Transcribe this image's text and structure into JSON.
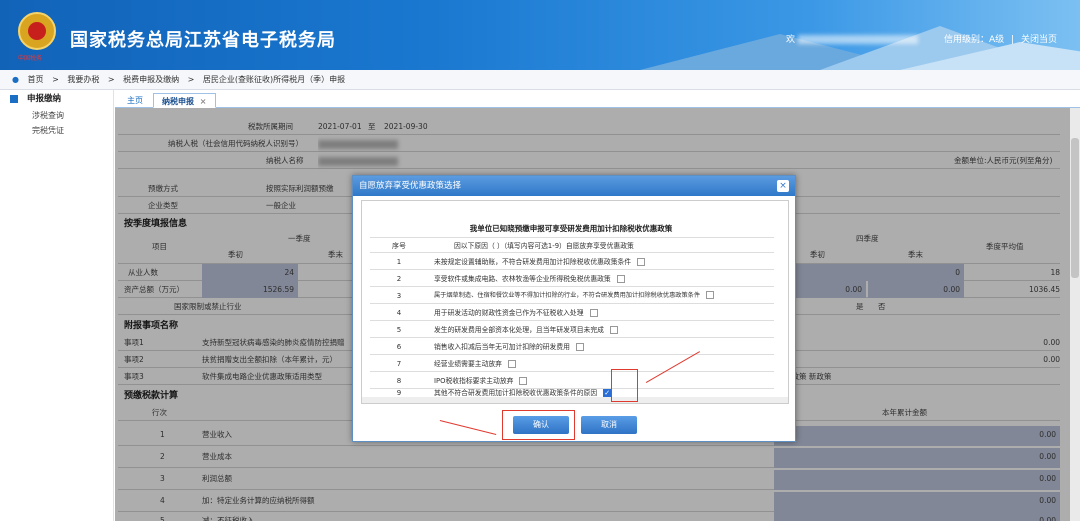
{
  "header": {
    "site_title": "国家税务总局江苏省电子税务局",
    "logo_sub": "中国税务",
    "welcome_prefix": "欢",
    "credit_label": "信用级别：A级",
    "sep": "|",
    "close_label": "关闭当页",
    "colors": {
      "primary": "#1a78d0",
      "accent": "#2e73c5",
      "highlight": "#e03a2f"
    }
  },
  "breadcrumb": {
    "home": "首页",
    "sep": ">",
    "items": [
      "我要办税",
      "税费申报及缴纳",
      "居民企业(查账征收)所得税月（季）申报"
    ],
    "icon": "location-icon"
  },
  "sidebar": {
    "title": "申报缴纳",
    "items": [
      "涉税查询",
      "完税凭证"
    ]
  },
  "tabs": [
    {
      "label": "主页",
      "active": false
    },
    {
      "label": "纳税申报",
      "active": true,
      "close": "×"
    }
  ],
  "form": {
    "period_label": "税款所属期间",
    "period_start": "2021-07-01",
    "period_to": "至",
    "period_end": "2021-09-30",
    "taxpayer_id_label": "纳税人税（社会信用代码纳税人识别号）",
    "taxpayer_name_label": "纳税人名称",
    "unit_label": "金额单位:人民币元(列至角分)",
    "method_label": "预缴方式",
    "method_value": "按照实际利润额预缴",
    "enterprise_label": "企业类型",
    "enterprise_value": "一般企业",
    "quarter_section": "按季度填报信息",
    "item_label": "项目",
    "q1_label": "一季度",
    "q4_label": "四季度",
    "avg_label": "季度平均值",
    "begin_label": "季初",
    "end_label": "季末",
    "employees_label": "从业人数",
    "employees_q1_begin": "24",
    "employees_q4_begin": "0",
    "employees_q4_end": "0",
    "employees_avg": "18",
    "assets_label": "资产总额（万元）",
    "assets_q1_begin": "1526.59",
    "assets_q4_begin": "0.00",
    "assets_q4_end": "0.00",
    "assets_avg": "1036.45",
    "restricted_label": "国家限制或禁止行业",
    "yes_label": "是",
    "no_label": "否",
    "attach_section": "附报事项名称",
    "attach_rows": [
      {
        "no": "事项1",
        "text": "支持新型冠状病毒感染的肺炎疫情防控捐赠",
        "value": "0.00"
      },
      {
        "no": "事项2",
        "text": "扶贫捐赠支出全额扣除（本年累计，元）",
        "value": "0.00"
      },
      {
        "no": "事项3",
        "text": "软件集成电路企业优惠政策适用类型",
        "value": "原政策 新政策"
      }
    ],
    "calc_section": "预缴税款计算",
    "row_label": "行次",
    "amount_label": "本年累计金额",
    "calc_rows": [
      {
        "no": "1",
        "text": "营业收入",
        "value": "0.00"
      },
      {
        "no": "2",
        "text": "营业成本",
        "value": "0.00"
      },
      {
        "no": "3",
        "text": "利润总额",
        "value": "0.00"
      },
      {
        "no": "4",
        "text": "加：特定业务计算的应纳税所得额",
        "value": "0.00"
      },
      {
        "no": "5",
        "text": "减：不征税收入",
        "value": "0.00"
      }
    ]
  },
  "dialog": {
    "title": "自愿放弃享受优惠政策选择",
    "close": "×",
    "heading": "我单位已知晓预缴申报可享受研发费用加计扣除税收优惠政策",
    "col_no": "序号",
    "col_reason": "因以下原因（ ）（填写内容可选1-9）自愿放弃享受优惠政策",
    "rows": [
      {
        "no": "1",
        "text": "未按规定设置辅助账，不符合研发费用加计扣除税收优惠政策条件",
        "checked": false
      },
      {
        "no": "2",
        "text": "享受软件或集成电路、农林牧渔等企业所得税免税优惠政策",
        "checked": false
      },
      {
        "no": "3",
        "text": "属于烟草制造、住宿和餐饮业等不得加计扣除的行业，不符合研发费用加计扣除税收优惠政策条件",
        "checked": false
      },
      {
        "no": "4",
        "text": "用于研发活动的财政性资金已作为不征税收入处理",
        "checked": false
      },
      {
        "no": "5",
        "text": "发生的研发费用全部资本化处理，且当年研发项目未完成",
        "checked": false
      },
      {
        "no": "6",
        "text": "销售收入扣减后当年无可加计扣除的研发费用",
        "checked": false
      },
      {
        "no": "7",
        "text": "经营业绩需要主动放弃",
        "checked": false
      },
      {
        "no": "8",
        "text": "IPO税收指标要求主动放弃",
        "checked": false
      },
      {
        "no": "9",
        "text": "其他不符合研发费用加计扣除税收优惠政策条件的原因",
        "checked": true
      }
    ],
    "confirm": "确认",
    "cancel": "取消"
  }
}
